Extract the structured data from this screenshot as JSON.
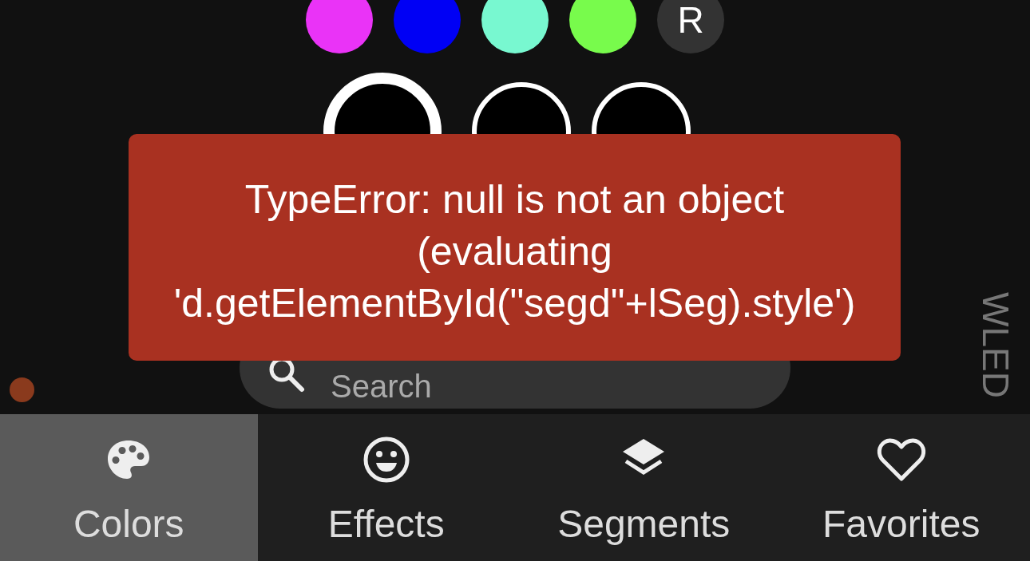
{
  "color_swatches": [
    {
      "color": "#ea33f7"
    },
    {
      "color": "#0000f5"
    },
    {
      "color": "#78f8d0"
    },
    {
      "color": "#78fb4c"
    }
  ],
  "reset_button": {
    "label": "R"
  },
  "color_slots": [
    {
      "selected": true
    },
    {
      "selected": false
    },
    {
      "selected": false
    }
  ],
  "error_toast": {
    "message": "TypeError: null is not an object (evaluating 'd.getElementById(\"segd\"+lSeg).style')"
  },
  "search": {
    "placeholder": "Search"
  },
  "connection_dot": {
    "color": "#8a3a1d"
  },
  "brand": {
    "text": "WLED"
  },
  "tabs": [
    {
      "kind": "palette",
      "label": "Colors",
      "selected": true
    },
    {
      "kind": "smiley",
      "label": "Effects",
      "selected": false
    },
    {
      "kind": "layers",
      "label": "Segments",
      "selected": false
    },
    {
      "kind": "heart",
      "label": "Favorites",
      "selected": false
    }
  ]
}
